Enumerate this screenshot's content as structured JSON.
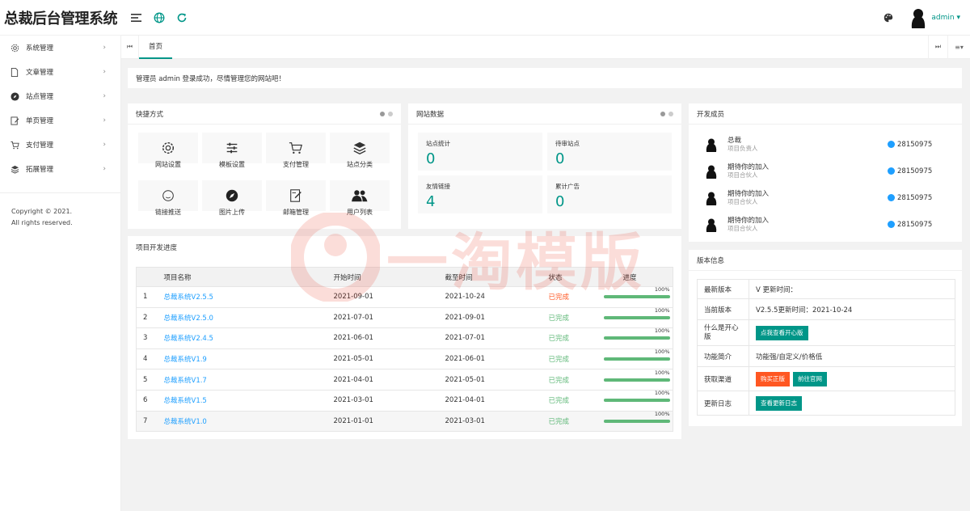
{
  "app": {
    "logo_text": "总裁后台管理系统"
  },
  "header": {
    "user_name": "admin ▾"
  },
  "sidebar": {
    "items": [
      {
        "label": "系统管理",
        "icon": "gear-icon"
      },
      {
        "label": "文章管理",
        "icon": "file-icon"
      },
      {
        "label": "站点管理",
        "icon": "compass-icon"
      },
      {
        "label": "单页管理",
        "icon": "edit-icon"
      },
      {
        "label": "支付管理",
        "icon": "cart-icon"
      },
      {
        "label": "拓展管理",
        "icon": "layers-icon"
      }
    ],
    "copyright_line1": "Copyright © 2021.",
    "copyright_line2": "All rights reserved."
  },
  "tabs": {
    "home_label": "首页"
  },
  "notice": {
    "text": "管理员 admin 登录成功，尽情管理您的网站吧！"
  },
  "quick": {
    "title": "快捷方式",
    "items": [
      {
        "label": "网站设置",
        "icon": "gear-icon"
      },
      {
        "label": "模板设置",
        "icon": "sliders-icon"
      },
      {
        "label": "支付管理",
        "icon": "cart-icon"
      },
      {
        "label": "站点分类",
        "icon": "layers-icon"
      },
      {
        "label": "链接推送",
        "icon": "smile-icon"
      },
      {
        "label": "图片上传",
        "icon": "compass-icon"
      },
      {
        "label": "邮箱管理",
        "icon": "edit-icon"
      },
      {
        "label": "用户列表",
        "icon": "users-icon"
      }
    ]
  },
  "stats": {
    "title": "网站数据",
    "items": [
      {
        "label": "站点统计",
        "value": "0"
      },
      {
        "label": "待审站点",
        "value": "0"
      },
      {
        "label": "友情链接",
        "value": "4"
      },
      {
        "label": "累计广告",
        "value": "0"
      }
    ]
  },
  "members": {
    "title": "开发成员",
    "items": [
      {
        "name": "总裁",
        "role": "项目负责人",
        "qq": "28150975"
      },
      {
        "name": "期待你的加入",
        "role": "项目合伙人",
        "qq": "28150975"
      },
      {
        "name": "期待你的加入",
        "role": "项目合伙人",
        "qq": "28150975"
      },
      {
        "name": "期待你的加入",
        "role": "项目合伙人",
        "qq": "28150975"
      }
    ]
  },
  "progress": {
    "title": "项目开发进度",
    "headers": [
      "",
      "项目名称",
      "开始时间",
      "截至时间",
      "状态",
      "进度"
    ],
    "rows": [
      {
        "no": "1",
        "name": "总裁系统V2.5.5",
        "start": "2021-09-01",
        "end": "2021-10-24",
        "status": "已完成",
        "status_color": "#ff5722",
        "pct": "100%",
        "fraction": 1.0
      },
      {
        "no": "2",
        "name": "总裁系统V2.5.0",
        "start": "2021-07-01",
        "end": "2021-09-01",
        "status": "已完成",
        "status_color": "#5fb878",
        "pct": "100%",
        "fraction": 1.0
      },
      {
        "no": "3",
        "name": "总裁系统V2.4.5",
        "start": "2021-06-01",
        "end": "2021-07-01",
        "status": "已完成",
        "status_color": "#5fb878",
        "pct": "100%",
        "fraction": 1.0
      },
      {
        "no": "4",
        "name": "总裁系统V1.9",
        "start": "2021-05-01",
        "end": "2021-06-01",
        "status": "已完成",
        "status_color": "#5fb878",
        "pct": "100%",
        "fraction": 1.0
      },
      {
        "no": "5",
        "name": "总裁系统V1.7",
        "start": "2021-04-01",
        "end": "2021-05-01",
        "status": "已完成",
        "status_color": "#5fb878",
        "pct": "100%",
        "fraction": 1.0
      },
      {
        "no": "6",
        "name": "总裁系统V1.5",
        "start": "2021-03-01",
        "end": "2021-04-01",
        "status": "已完成",
        "status_color": "#5fb878",
        "pct": "100%",
        "fraction": 1.0
      },
      {
        "no": "7",
        "name": "总裁系统V1.0",
        "start": "2021-01-01",
        "end": "2021-03-01",
        "status": "已完成",
        "status_color": "#5fb878",
        "pct": "100%",
        "fraction": 1.0
      }
    ]
  },
  "version": {
    "title": "版本信息",
    "latest_label": "最新版本",
    "latest_value": "V 更新时间：",
    "current_label": "当前版本",
    "current_value": "V2.5.5更新时间：2021-10-24",
    "happy_label": "什么是开心版",
    "happy_button": "点我查看开心版",
    "intro_label": "功能简介",
    "intro_value": "功能强/自定义/价格低",
    "channel_label": "获取渠道",
    "buy_button": "购买正版",
    "site_button": "前往官网",
    "log_label": "更新日志",
    "log_button": "查看更新日志"
  },
  "watermark": {
    "text": "一淘模版"
  },
  "colors": {
    "accent": "#009688",
    "link": "#1e9fff",
    "done": "#5fb878",
    "alert": "#ff5722"
  }
}
